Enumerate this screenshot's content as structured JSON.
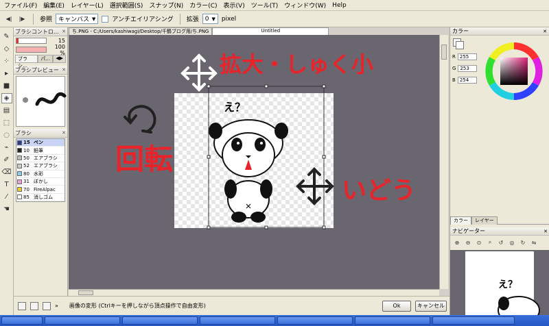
{
  "menubar": {
    "items": [
      "ファイル(F)",
      "編集(E)",
      "レイヤー(L)",
      "選択範囲(S)",
      "スナップ(N)",
      "カラー(C)",
      "表示(V)",
      "ツール(T)",
      "ウィンドウ(W)",
      "Help"
    ]
  },
  "toolbar": {
    "ref_label": "参照",
    "ref_value": "キャンバス",
    "antialias_label": "アンチエイリアシング",
    "expand_label": "拡張",
    "expand_value": "0",
    "unit_label": "pixel"
  },
  "brush_control": {
    "title": "ブラシコントロ…",
    "size_value": "15",
    "opacity_value": "100 %",
    "tabs": [
      "ブラシ…",
      "パ…"
    ]
  },
  "brush_preview": {
    "title": "ブラシプレビュー"
  },
  "brushes": {
    "title": "ブラシ",
    "items": [
      {
        "size": "15",
        "name": "ペン",
        "color": "#2a3a8c",
        "selected": true
      },
      {
        "size": "10",
        "name": "鉛筆",
        "color": "#222222",
        "selected": false
      },
      {
        "size": "50",
        "name": "エアブラシ",
        "color": "#bbbbbb",
        "selected": false
      },
      {
        "size": "52",
        "name": "エアブラシ",
        "color": "#cccccc",
        "selected": false
      },
      {
        "size": "80",
        "name": "水彩",
        "color": "#8ecde8",
        "selected": false
      },
      {
        "size": "31",
        "name": "ぼかし",
        "color": "#f0a0d8",
        "selected": false
      },
      {
        "size": "70",
        "name": "FireAlpac",
        "color": "#f0c828",
        "selected": false
      },
      {
        "size": "85",
        "name": "消しゴム",
        "color": "#ffffff",
        "selected": false
      }
    ]
  },
  "document_tabs": [
    {
      "label": "ち.PNG - C:/Users/kashiwagi/Desktop/千鶴ブログ用/ち.PNG",
      "active": false
    },
    {
      "label": "Untitled",
      "active": true
    }
  ],
  "status_bar": {
    "text": "画像の変形 (Ctrlキーを押しながら頂点操作で自由変形)",
    "ok_label": "Ok",
    "cancel_label": "キャンセル"
  },
  "annotations": {
    "zoom": "拡大・しゅく小",
    "rotate": "回転",
    "move": "いどう"
  },
  "canvas_text": "え？",
  "color_panel": {
    "title": "カラー",
    "r_label": "R",
    "r_value": "255",
    "g_label": "G",
    "g_value": "253",
    "b_label": "B",
    "b_value": "254",
    "tabs": [
      "カラー",
      "レイヤー"
    ]
  },
  "navigator": {
    "title": "ナビゲーター"
  },
  "colors": {
    "annotation": "#e8242a",
    "canvas_bg": "#6a6670",
    "selected_row": "#c9d4f4"
  }
}
